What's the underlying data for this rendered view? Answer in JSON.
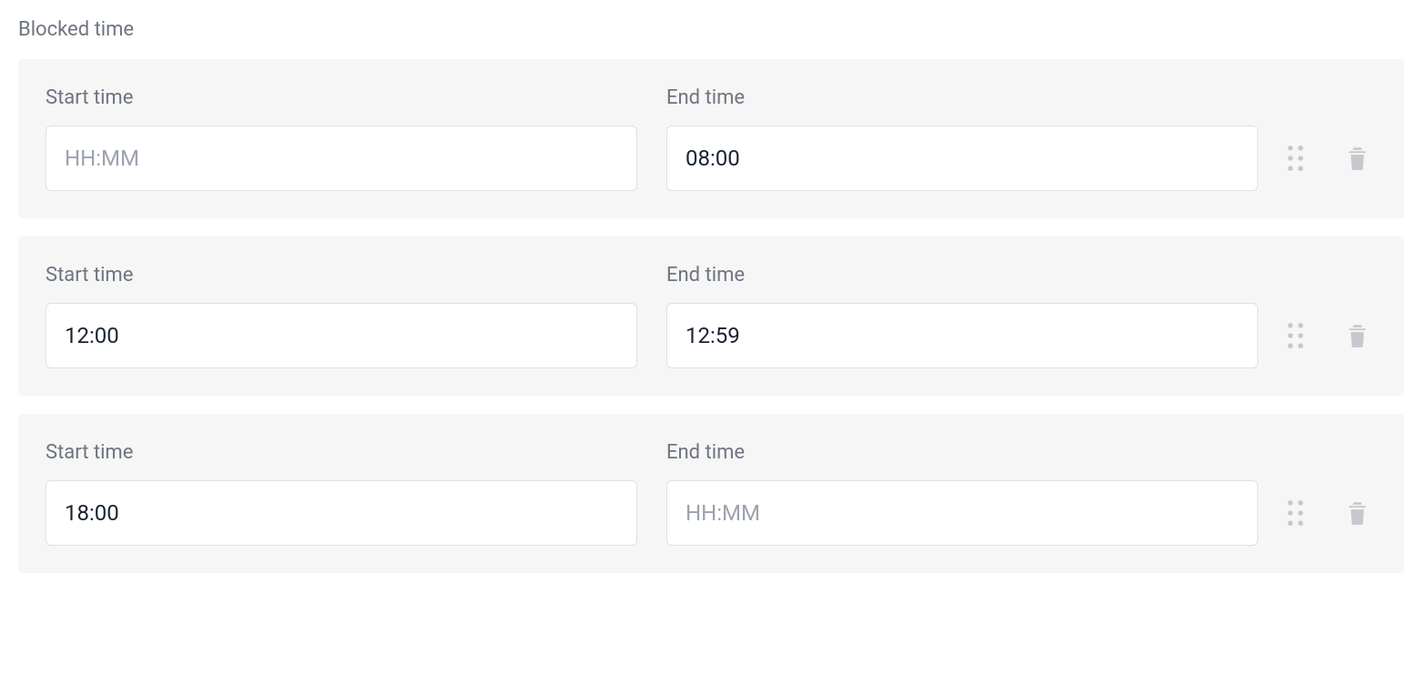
{
  "section": {
    "title": "Blocked time"
  },
  "labels": {
    "start": "Start time",
    "end": "End time"
  },
  "placeholder": "HH:MM",
  "rows": [
    {
      "start": "",
      "end": "08:00"
    },
    {
      "start": "12:00",
      "end": "12:59"
    },
    {
      "start": "18:00",
      "end": ""
    }
  ]
}
